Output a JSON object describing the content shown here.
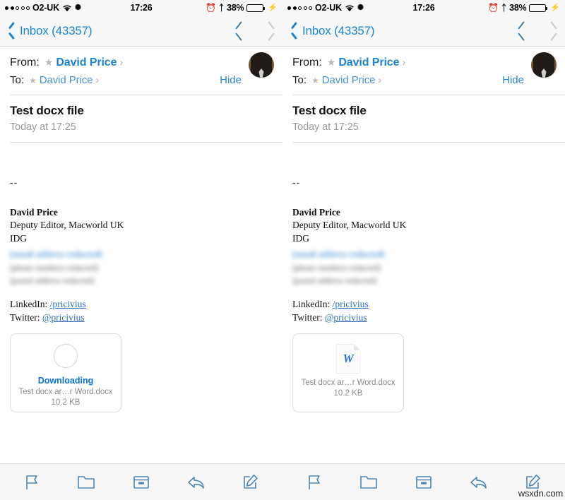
{
  "status_bar": {
    "carrier": "O2-UK",
    "signal_dots_filled": 2,
    "signal_dots_total": 5,
    "wifi_icon": "wifi-icon",
    "snow_icon": "snowflake-icon",
    "time": "17:26",
    "alarm_icon": "alarm-clock-icon",
    "bluetooth_icon": "bluetooth-icon",
    "battery_percent": "38%",
    "battery_level": 38,
    "battery_fill_color": "#4cd964",
    "charging_icon": "lightning-bolt-icon"
  },
  "nav_bar": {
    "back_label": "Inbox (43357)",
    "back_icon": "chevron-left-icon",
    "prev_icon": "chevron-up-icon",
    "next_icon": "chevron-down-icon",
    "prev_enabled": true,
    "next_enabled": false,
    "enabled_color": "#3c7fb1",
    "disabled_color": "#c9c9c9"
  },
  "header": {
    "from_label": "From:",
    "from_name": "David Price",
    "to_label": "To:",
    "to_name": "David Price",
    "star_icon": "star-icon",
    "disclosure_icon": "chevron-right-icon",
    "hide_label": "Hide",
    "avatar": "contact-avatar-photo",
    "link_color": "#1a84d8"
  },
  "message": {
    "subject": "Test docx file",
    "date": "Today at 17:25",
    "separator_dashes": "--",
    "signature": {
      "name": "David Price",
      "title": "Deputy Editor, Macworld UK",
      "company": "IDG",
      "redacted_email": "[email address redacted]",
      "redacted_phone": "[phone numbers redacted]",
      "redacted_address": "[postal address redacted]"
    },
    "social": [
      {
        "label": "LinkedIn:",
        "link": "/pricivius"
      },
      {
        "label": "Twitter:",
        "link": "@pricivius"
      }
    ]
  },
  "attachment_left": {
    "state_label": "Downloading",
    "state_icon": "progress-ring-icon",
    "filename": "Test docx ar…r Word.docx",
    "filesize": "10.2 KB",
    "accent_color": "#0a72d8"
  },
  "attachment_right": {
    "state_icon": "word-document-icon",
    "icon_letter": "W",
    "filename": "Test docx ar…r Word.docx",
    "filesize": "10.2 KB"
  },
  "toolbar": {
    "items": [
      {
        "name": "flag-icon",
        "label": "Flag"
      },
      {
        "name": "folder-icon",
        "label": "Move to folder"
      },
      {
        "name": "archive-icon",
        "label": "Archive"
      },
      {
        "name": "reply-icon",
        "label": "Reply"
      },
      {
        "name": "compose-icon",
        "label": "Compose"
      }
    ],
    "icon_color": "#4e85b5"
  },
  "watermark": "wsxdn.com"
}
